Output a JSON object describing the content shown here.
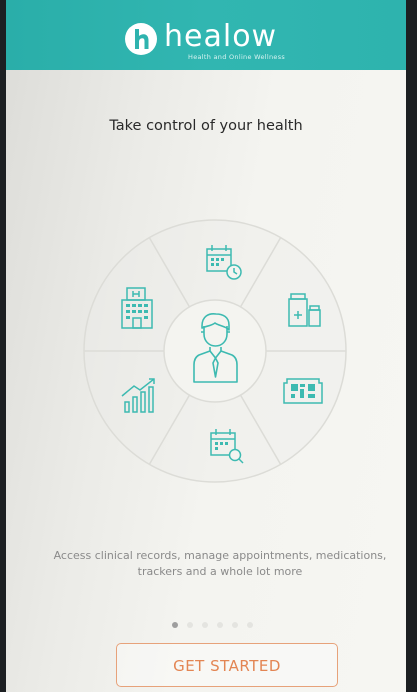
{
  "header": {
    "logo_text": "healow",
    "logo_tagline": "Health and Online Wellness"
  },
  "intro": {
    "title": "Take control of your health",
    "description_line1": "Access clinical records, manage appointments, medications,",
    "description_line2": "trackers and a whole lot more",
    "button_label": "GET STARTED"
  },
  "pager": {
    "total": 6,
    "active": 1
  },
  "wheel": {
    "center_icon": "doctor-icon",
    "segments": [
      "calendar-clock-icon",
      "medications-icon",
      "barcode-icon",
      "calendar-search-icon",
      "growth-chart-icon",
      "hospital-icon"
    ]
  },
  "colors": {
    "brand": "#2eb3ae",
    "icon": "#3dbab1",
    "button": "#e38553"
  }
}
